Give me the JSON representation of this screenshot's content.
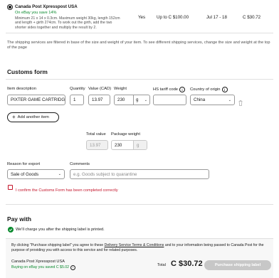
{
  "shipping_option": {
    "name": "Canada Post Xpresspost USA",
    "savings": "On eBay you save 14%",
    "desc": "Minimum 21 x 14 x 0.3cm. Maximum weight 30kg, length 152cm and length + girth 274cm. To work out the girth, add the two shorter sides together and multiply the result by 2.",
    "tracking": "Yes",
    "coverage": "Up to C $100.00",
    "delivery": "Jul 17 - 18",
    "price": "C $30.72"
  },
  "filter_note": "The shipping services are filtered in base of the size and weight of your item. To see different shipping services, change the size and weight at the top of the page",
  "customs": {
    "heading": "Customs form",
    "col_item_desc": "Item description",
    "col_quantity": "Quantity",
    "col_value": "Value (CAD)",
    "col_weight": "Weight",
    "col_hs": "HS tariff code",
    "col_country": "Country of origin",
    "item_desc": "PIXTER GAME CARTRIDGE",
    "quantity": "1",
    "value": "13.97",
    "weight": "230",
    "weight_unit": "g",
    "hs_code": "",
    "country": "China",
    "add_item": "Add another item",
    "total_value_label": "Total value",
    "package_weight_label": "Package weight",
    "total_value": "13.97",
    "package_weight": "230",
    "package_weight_unit": "g",
    "reason_label": "Reason for export",
    "reason": "Sale of Goods",
    "comments_label": "Comments",
    "comments_placeholder": "e.g. Goods subject to quarantine",
    "confirm_text": "I confirm the Customs Form has been completed correctly"
  },
  "pay": {
    "heading": "Pay with",
    "charge_note": "We'll charge you after the shipping label is printed."
  },
  "footer": {
    "agreement_prefix": "By clicking \"Purchase shipping label\" you agree to these ",
    "agreement_link": "Delivery Service Terms & Conditions",
    "agreement_suffix": " and to your information being passed to Canada Post for the purpose of providing you with access to this service and for related purposes.",
    "service_name": "Canada Post Xpresspost USA",
    "savings": "Buying on eBay you saved C $5.02",
    "total_label": "Total",
    "total": "C $30.72",
    "purchase_button": "Purchase shipping label"
  },
  "colors": {
    "accent": "#0a8a2e",
    "error": "#c4142a",
    "link": "#1a5ed4",
    "button_disabled": "#c7c7c7"
  }
}
